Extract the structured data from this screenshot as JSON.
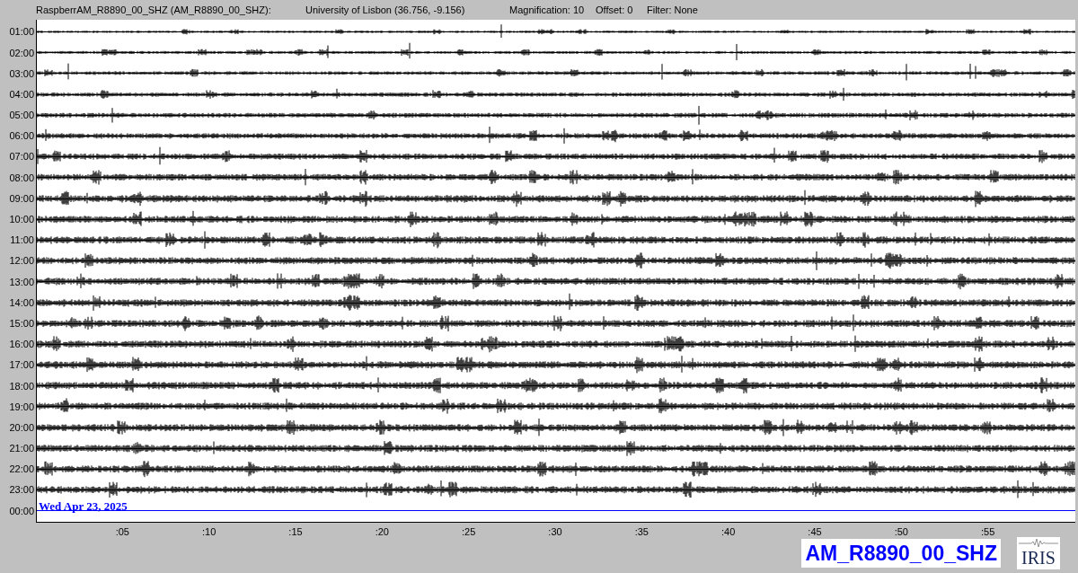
{
  "header": {
    "station": "RaspberrAM_R8890_00_SHZ (AM_R8890_00_SHZ):",
    "location": "University of Lisbon (36.756, -9.156)",
    "magnification": "Magnification: 10",
    "offset": "Offset: 0",
    "filter": "Filter: None"
  },
  "plot": {
    "rows": [
      {
        "label": "01:00",
        "kind": "trace"
      },
      {
        "label": "02:00",
        "kind": "trace"
      },
      {
        "label": "03:00",
        "kind": "trace"
      },
      {
        "label": "04:00",
        "kind": "trace"
      },
      {
        "label": "05:00",
        "kind": "trace"
      },
      {
        "label": "06:00",
        "kind": "trace"
      },
      {
        "label": "07:00",
        "kind": "trace"
      },
      {
        "label": "08:00",
        "kind": "trace"
      },
      {
        "label": "09:00",
        "kind": "trace"
      },
      {
        "label": "10:00",
        "kind": "trace"
      },
      {
        "label": "11:00",
        "kind": "trace"
      },
      {
        "label": "12:00",
        "kind": "trace"
      },
      {
        "label": "13:00",
        "kind": "trace"
      },
      {
        "label": "14:00",
        "kind": "trace"
      },
      {
        "label": "15:00",
        "kind": "trace"
      },
      {
        "label": "16:00",
        "kind": "trace"
      },
      {
        "label": "17:00",
        "kind": "trace"
      },
      {
        "label": "18:00",
        "kind": "trace"
      },
      {
        "label": "19:00",
        "kind": "trace"
      },
      {
        "label": "20:00",
        "kind": "trace"
      },
      {
        "label": "21:00",
        "kind": "trace"
      },
      {
        "label": "22:00",
        "kind": "trace"
      },
      {
        "label": "23:00",
        "kind": "trace"
      },
      {
        "label": "00:00",
        "kind": "current"
      }
    ],
    "date": "Wed Apr 23, 2025",
    "x_ticks": [
      ":05",
      ":10",
      ":15",
      ":20",
      ":25",
      ":30",
      ":35",
      ":40",
      ":45",
      ":50",
      ":55"
    ]
  },
  "station_label": "AM_R8890_00_SHZ",
  "logo": {
    "text": "IRIS"
  }
}
